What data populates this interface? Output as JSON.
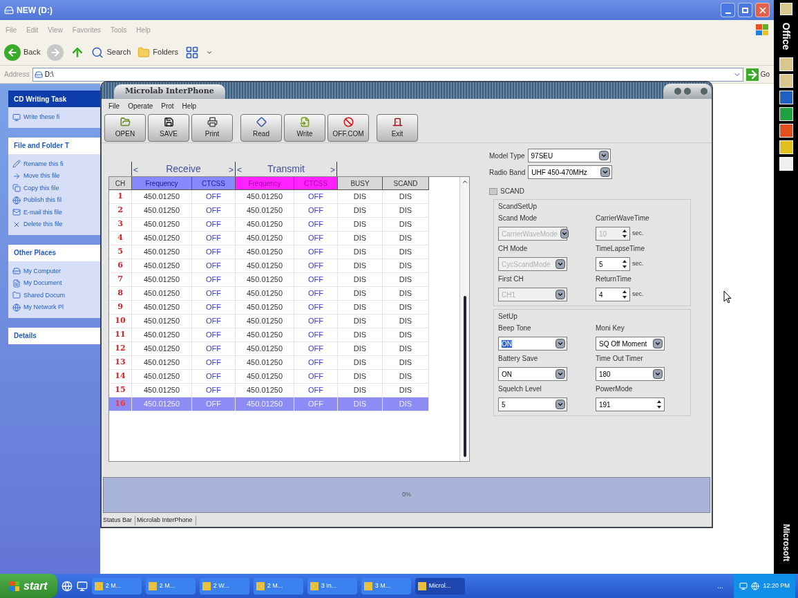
{
  "explorer": {
    "title": "NEW (D:)",
    "menu": [
      "File",
      "Edit",
      "View",
      "Favorites",
      "Tools",
      "Help"
    ],
    "toolbar": [
      "Back",
      "Search",
      "Folders"
    ],
    "address": {
      "label": "Address",
      "value": "D:\\",
      "go": "Go"
    },
    "panels": [
      {
        "title": "CD Writing Task",
        "dark": true,
        "items": [
          "Write these fi"
        ]
      },
      {
        "title": "File and Folder T",
        "dark": false,
        "items": [
          "Rename this fi",
          "Move this file",
          "Copy this file",
          "Publish this fil",
          "E-mail this file",
          "Delete this file"
        ]
      },
      {
        "title": "Other Places",
        "dark": false,
        "items": [
          "My Computer",
          "My Document",
          "Shared Docum",
          "My Network Pl"
        ]
      },
      {
        "title": "Details",
        "dark": false
      }
    ]
  },
  "app": {
    "title": "Microlab InterPhone",
    "menu": [
      "File",
      "Operate",
      "Prot",
      "Help"
    ],
    "toolbar": [
      "OPEN",
      "SAVE",
      "Print",
      "Read",
      "Write",
      "OFF.COM",
      "Exit"
    ],
    "groups": [
      {
        "left": "<",
        "label": "Receive",
        "right": ">"
      },
      {
        "left": "<",
        "label": "Transmit",
        "right": ">"
      }
    ],
    "columns": [
      {
        "label": "CH",
        "kind": "ch"
      },
      {
        "label": "Frequency",
        "kind": "rx"
      },
      {
        "label": "CTCSS",
        "kind": "rx"
      },
      {
        "label": "Frequency",
        "kind": "tx"
      },
      {
        "label": "CTCSS",
        "kind": "tx"
      },
      {
        "label": "BUSY",
        "kind": "plain"
      },
      {
        "label": "SCAND",
        "kind": "plain"
      }
    ],
    "rows": [
      {
        "cells": [
          "1",
          "450.01250",
          "OFF",
          "450.01250",
          "OFF",
          "DIS",
          "DIS"
        ],
        "selected": false
      },
      {
        "cells": [
          "2",
          "450.01250",
          "OFF",
          "450.01250",
          "OFF",
          "DIS",
          "DIS"
        ],
        "selected": false
      },
      {
        "cells": [
          "3",
          "450.01250",
          "OFF",
          "450.01250",
          "OFF",
          "DIS",
          "DIS"
        ],
        "selected": false
      },
      {
        "cells": [
          "4",
          "450.01250",
          "OFF",
          "450.01250",
          "OFF",
          "DIS",
          "DIS"
        ],
        "selected": false
      },
      {
        "cells": [
          "5",
          "450.01250",
          "OFF",
          "450.01250",
          "OFF",
          "DIS",
          "DIS"
        ],
        "selected": false
      },
      {
        "cells": [
          "6",
          "450.01250",
          "OFF",
          "450.01250",
          "OFF",
          "DIS",
          "DIS"
        ],
        "selected": false
      },
      {
        "cells": [
          "7",
          "450.01250",
          "OFF",
          "450.01250",
          "OFF",
          "DIS",
          "DIS"
        ],
        "selected": false
      },
      {
        "cells": [
          "8",
          "450.01250",
          "OFF",
          "450.01250",
          "OFF",
          "DIS",
          "DIS"
        ],
        "selected": false
      },
      {
        "cells": [
          "9",
          "450.01250",
          "OFF",
          "450.01250",
          "OFF",
          "DIS",
          "DIS"
        ],
        "selected": false
      },
      {
        "cells": [
          "10",
          "450.01250",
          "OFF",
          "450.01250",
          "OFF",
          "DIS",
          "DIS"
        ],
        "selected": false
      },
      {
        "cells": [
          "11",
          "450.01250",
          "OFF",
          "450.01250",
          "OFF",
          "DIS",
          "DIS"
        ],
        "selected": false
      },
      {
        "cells": [
          "12",
          "450.01250",
          "OFF",
          "450.01250",
          "OFF",
          "DIS",
          "DIS"
        ],
        "selected": false
      },
      {
        "cells": [
          "13",
          "450.01250",
          "OFF",
          "450.01250",
          "OFF",
          "DIS",
          "DIS"
        ],
        "selected": false
      },
      {
        "cells": [
          "14",
          "450.01250",
          "OFF",
          "450.01250",
          "OFF",
          "DIS",
          "DIS"
        ],
        "selected": false
      },
      {
        "cells": [
          "15",
          "450.01250",
          "OFF",
          "450.01250",
          "OFF",
          "DIS",
          "DIS"
        ],
        "selected": false
      },
      {
        "cells": [
          "16",
          "450.01250",
          "OFF",
          "450.01250",
          "OFF",
          "DIS",
          "DIS"
        ],
        "selected": true
      }
    ],
    "model_type": {
      "label": "Model Type",
      "value": "97SEU"
    },
    "radio_band": {
      "label": "Radio Band",
      "value": "UHF 450-470MHz"
    },
    "scand": {
      "label": "SCAND",
      "checked": false
    },
    "scand_setup": {
      "title": "ScandSetUp",
      "fields": [
        {
          "label": "Scand Mode",
          "kind": "dropdown",
          "value": "CarrierWaveMode",
          "disabled": true
        },
        {
          "label": "CarrierWaveTime",
          "kind": "spin",
          "value": "10",
          "unit": "sec.",
          "disabled": true
        },
        {
          "label": "CH Mode",
          "kind": "dropdown",
          "value": "CycScandMode",
          "disabled": true
        },
        {
          "label": "TimeLapseTime",
          "kind": "spin",
          "value": "5",
          "unit": "sec.",
          "disabled": false
        },
        {
          "label": "First CH",
          "kind": "dropdown",
          "value": "CH1",
          "disabled": true
        },
        {
          "label": "ReturnTime",
          "kind": "spin",
          "value": "4",
          "unit": "sec.",
          "disabled": false
        }
      ]
    },
    "setup": {
      "title": "SetUp",
      "fields": [
        {
          "label": "Beep Tone",
          "kind": "dropdown",
          "value": "ON",
          "disabled": false,
          "text_selected": true
        },
        {
          "label": "Moni Key",
          "kind": "dropdown",
          "value": "SQ Off Moment",
          "disabled": false,
          "text_selected": false
        },
        {
          "label": "Battery Save",
          "kind": "dropdown",
          "value": "ON",
          "disabled": false,
          "text_selected": false
        },
        {
          "label": "Time Out Timer",
          "kind": "dropdown",
          "value": "180",
          "disabled": false,
          "text_selected": false
        },
        {
          "label": "Squelch Level",
          "kind": "dropdown",
          "value": "5",
          "disabled": false,
          "text_selected": false
        },
        {
          "label": "PowerMode",
          "kind": "spin",
          "value": "191",
          "disabled": false,
          "text_selected": false
        }
      ]
    },
    "progress": {
      "level": 0,
      "reading": "0%"
    },
    "status_bar": [
      "Status Bar",
      "Microlab InterPhone"
    ]
  },
  "office_bar": {
    "top": "Office",
    "bottom": "Microsoft"
  },
  "taskbar": {
    "start": "start",
    "items": [
      "2 M...",
      "2 M...",
      "2 W...",
      "2 M...",
      "3 In...",
      "3 M...",
      "Microl..."
    ],
    "tray_more": "...",
    "clock": "12:20 PM"
  }
}
